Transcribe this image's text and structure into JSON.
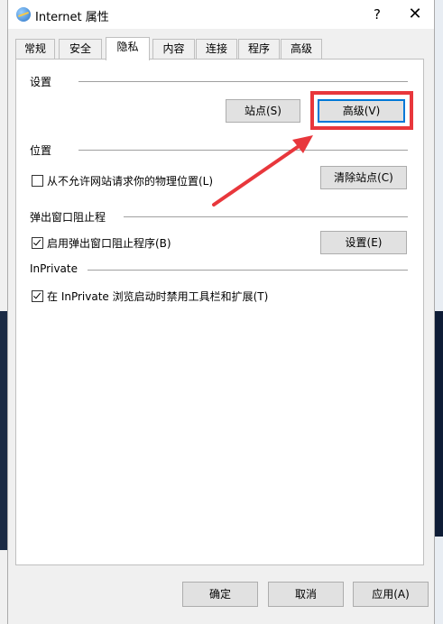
{
  "window": {
    "title": "Internet 属性",
    "help_label": "?",
    "close_label": "✕"
  },
  "tabs": [
    {
      "label": "常规"
    },
    {
      "label": "安全"
    },
    {
      "label": "隐私"
    },
    {
      "label": "内容"
    },
    {
      "label": "连接"
    },
    {
      "label": "程序"
    },
    {
      "label": "高级"
    }
  ],
  "active_tab": "隐私",
  "settings": {
    "label": "设置",
    "sites_button": "站点(S)",
    "advanced_button": "高级(V)"
  },
  "location": {
    "label": "位置",
    "checkbox_label": "从不允许网站请求你的物理位置(L)",
    "checked": false,
    "clear_button": "清除站点(C)"
  },
  "popup": {
    "label": "弹出窗口阻止程",
    "checkbox_label": "启用弹出窗口阻止程序(B)",
    "checked": true,
    "settings_button": "设置(E)"
  },
  "inprivate": {
    "label": "InPrivate",
    "checkbox_label": "在 InPrivate 浏览启动时禁用工具栏和扩展(T)",
    "checked": true
  },
  "footer": {
    "ok": "确定",
    "cancel": "取消",
    "apply": "应用(A)"
  },
  "colors": {
    "highlight": "#e8373c",
    "accent": "#0078d7"
  }
}
